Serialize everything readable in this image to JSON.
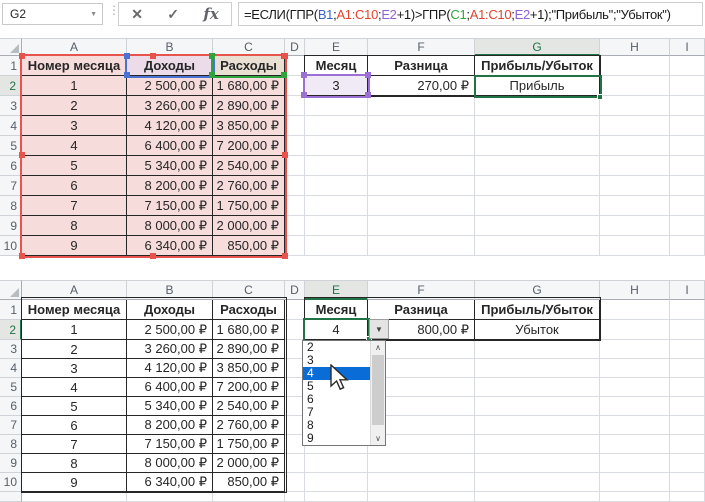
{
  "formula_bar": {
    "name_box_value": "G2",
    "cancel_label": "✕",
    "enter_label": "✓",
    "fx_label": "fx",
    "formula_segments": [
      {
        "text": "=ЕСЛИ(ГПР(",
        "color": "#1a1a1a"
      },
      {
        "text": "B1",
        "color": "#3763c5"
      },
      {
        "text": ";",
        "color": "#1a1a1a"
      },
      {
        "text": "A1:C10",
        "color": "#e0432d"
      },
      {
        "text": ";",
        "color": "#1a1a1a"
      },
      {
        "text": "E2",
        "color": "#9061d9"
      },
      {
        "text": "+1)>ГПР(",
        "color": "#1a1a1a"
      },
      {
        "text": "C1",
        "color": "#2fa33c"
      },
      {
        "text": ";",
        "color": "#1a1a1a"
      },
      {
        "text": "A1:C10",
        "color": "#e0432d"
      },
      {
        "text": ";",
        "color": "#1a1a1a"
      },
      {
        "text": "E2",
        "color": "#9061d9"
      },
      {
        "text": "+1);\"Прибыль\";\"Убыток\")",
        "color": "#1a1a1a"
      }
    ]
  },
  "column_letters": [
    "A",
    "B",
    "C",
    "D",
    "E",
    "F",
    "G",
    "H",
    "I"
  ],
  "row_numbers": [
    "1",
    "2",
    "3",
    "4",
    "5",
    "6",
    "7",
    "8",
    "9",
    "10"
  ],
  "table": {
    "headers": {
      "a": "Номер месяца",
      "b": "Доходы",
      "c": "Расходы",
      "e": "Месяц",
      "f": "Разница",
      "g": "Прибыль/Убыток"
    },
    "rows": [
      {
        "month": "1",
        "income": "2 500,00 ₽",
        "expense": "1 680,00 ₽"
      },
      {
        "month": "2",
        "income": "3 260,00 ₽",
        "expense": "2 890,00 ₽"
      },
      {
        "month": "3",
        "income": "4 120,00 ₽",
        "expense": "3 850,00 ₽"
      },
      {
        "month": "4",
        "income": "6 400,00 ₽",
        "expense": "7 200,00 ₽"
      },
      {
        "month": "5",
        "income": "5 340,00 ₽",
        "expense": "2 540,00 ₽"
      },
      {
        "month": "6",
        "income": "8 200,00 ₽",
        "expense": "2 760,00 ₽"
      },
      {
        "month": "7",
        "income": "7 150,00 ₽",
        "expense": "1 750,00 ₽"
      },
      {
        "month": "8",
        "income": "8 000,00 ₽",
        "expense": "2 000,00 ₽"
      },
      {
        "month": "9",
        "income": "6 340,00 ₽",
        "expense": "850,00 ₽"
      }
    ]
  },
  "top_sheet": {
    "month_value": "3",
    "difference": "270,00 ₽",
    "result": "Прибыль"
  },
  "bottom_sheet": {
    "month_value": "4",
    "difference": "800,00 ₽",
    "result": "Убыток",
    "dropdown": {
      "items": [
        "2",
        "3",
        "4",
        "5",
        "6",
        "7",
        "8",
        "9"
      ],
      "selected": "4",
      "up_icon": "∧",
      "down_icon": "∨"
    }
  },
  "colors": {
    "selection_green": "#217346",
    "range_red": "#e8534e",
    "ref_blue": "#4a72d4",
    "ref_green": "#2fa33c",
    "ref_purple": "#9b6fd4",
    "range_fill_pink": "#f7dcdc",
    "b1_fill": "#ecdbe9",
    "c1_fill": "#e9dfd3",
    "e2_fill": "#f0eaf6",
    "dropdown_selection_blue": "#0a6cd6"
  }
}
